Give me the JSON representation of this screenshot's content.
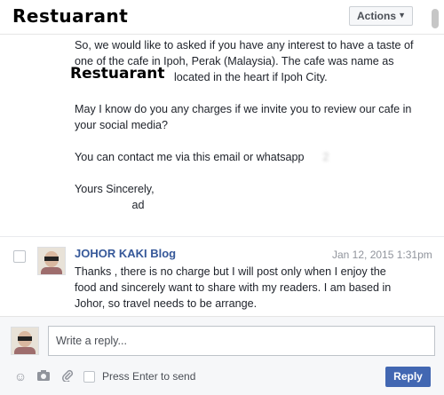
{
  "header": {
    "title": "Restuarant",
    "actions_label": "Actions"
  },
  "message": {
    "lines": [
      "So, we would like to asked if you have any interest to have a taste of",
      "one of the cafe in Ipoh, Perak (Malaysia). The cafe was name as",
      "located in the heart if Ipoh City.",
      "",
      "May I know do you any charges if we invite you to review our cafe in",
      "your social media?",
      "",
      "You can contact me via this email or whatsapp",
      "",
      "Yours Sincerely,",
      "ad"
    ],
    "overlay_label": "Restuarant"
  },
  "reply": {
    "author": "JOHOR KAKI Blog",
    "date": "Jan 12, 2015 1:31pm",
    "text_lines": [
      "Thanks , there is no charge but I will post only when I enjoy the",
      "food and sincerely want to share with my readers. I am based in",
      "Johor, so travel needs to be arrange."
    ]
  },
  "composer": {
    "placeholder": "Write a reply...",
    "press_enter_label": "Press Enter to send",
    "reply_label": "Reply",
    "icons": [
      "smiley-icon",
      "camera-icon",
      "attachment-icon"
    ]
  },
  "colors": {
    "link_blue": "#365899",
    "button_blue": "#4267b2",
    "meta_gray": "#90949c"
  }
}
